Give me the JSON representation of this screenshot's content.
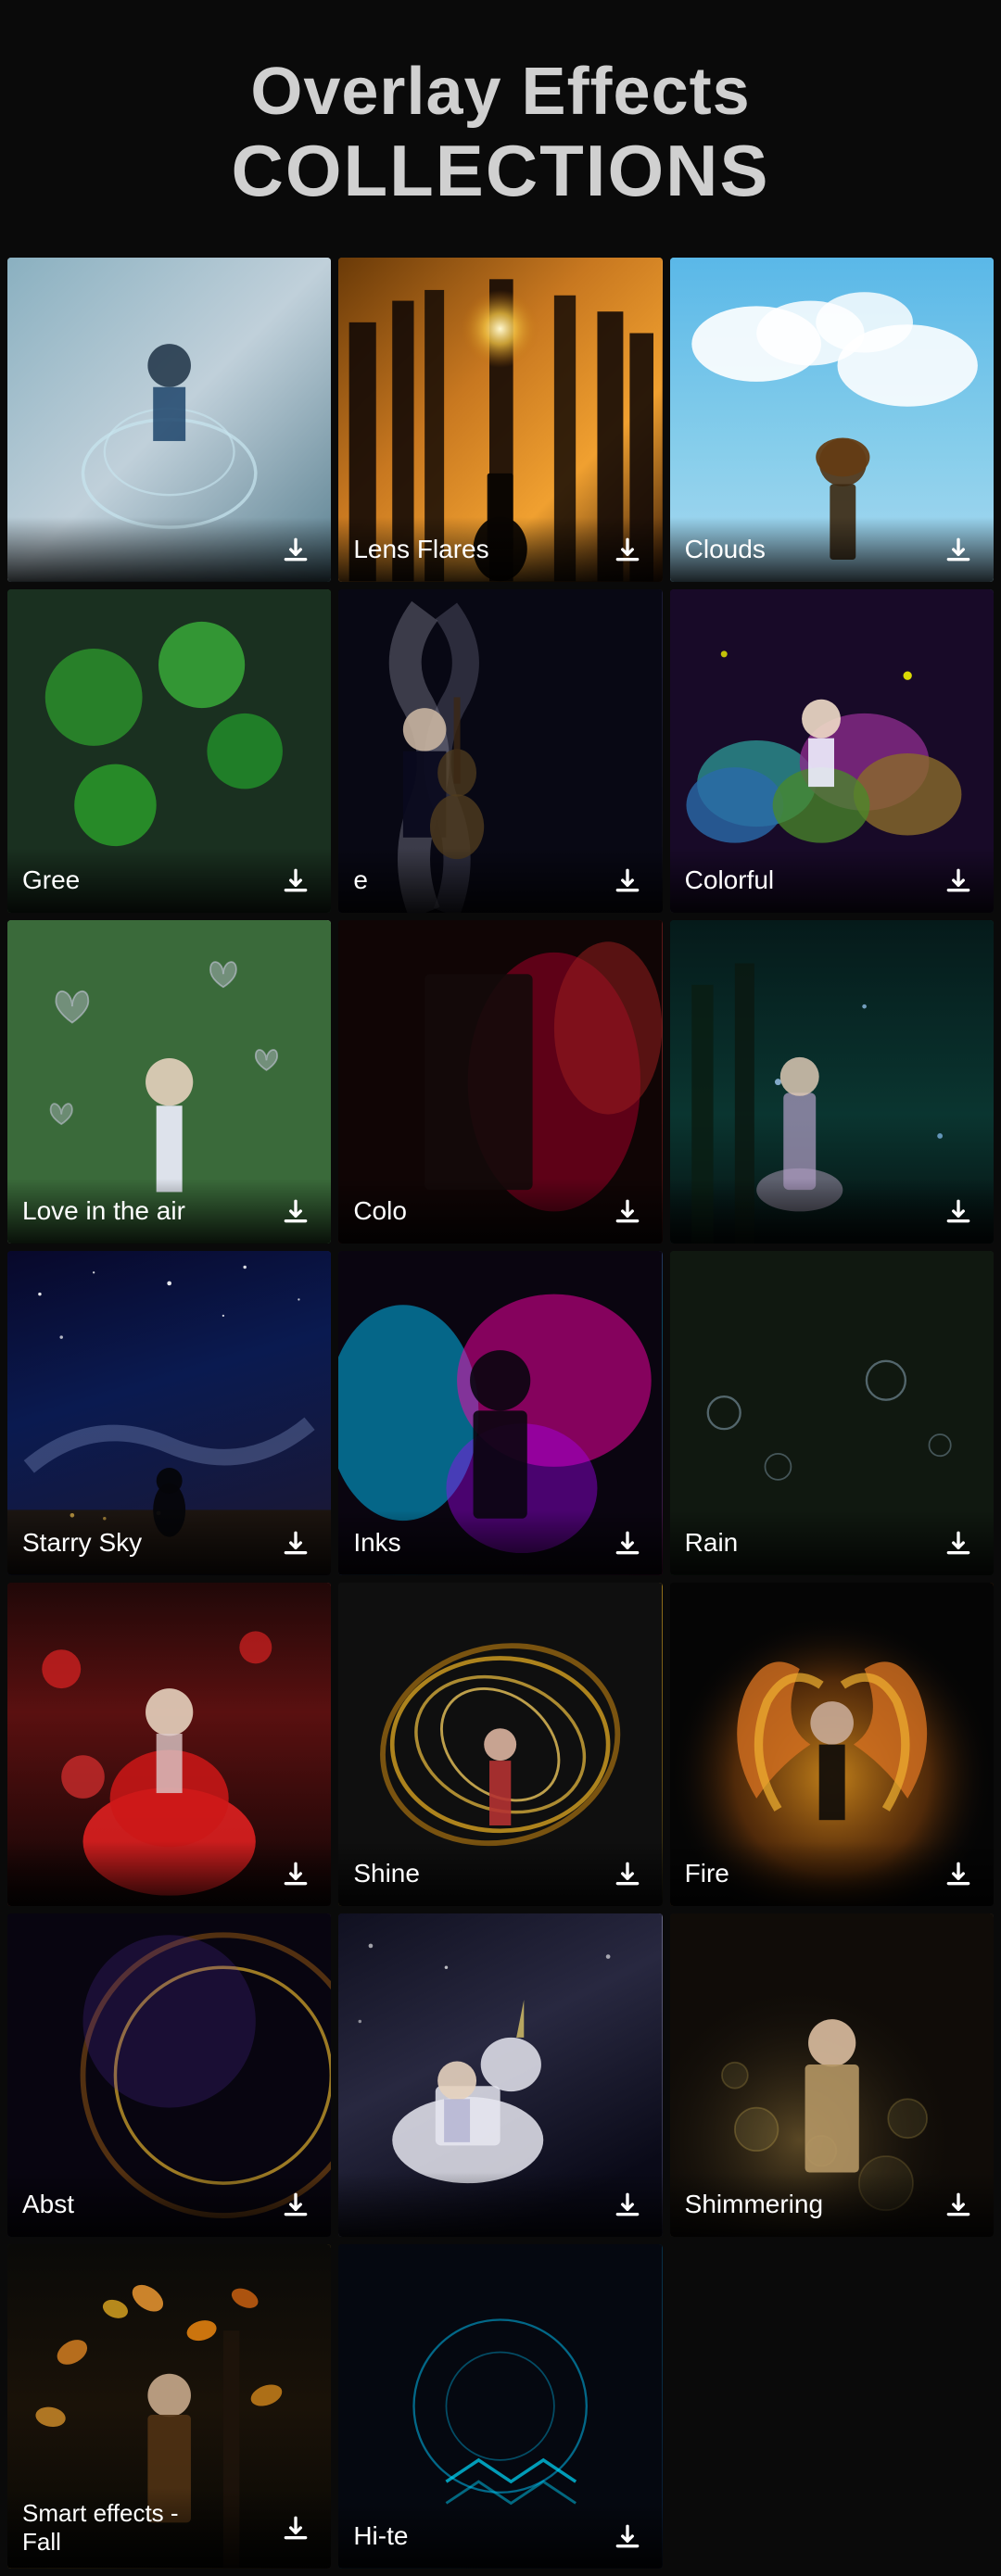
{
  "header": {
    "title": "Overlay Effects",
    "subtitle": "COLLECTIONS"
  },
  "grid": {
    "items": [
      {
        "id": "water-horse",
        "label": "",
        "imgClass": "img-water-horse",
        "hasLabel": false,
        "emoji": "🌊"
      },
      {
        "id": "lens-flares",
        "label": "Lens Flares",
        "imgClass": "img-lens-flare",
        "hasLabel": true,
        "emoji": "✨"
      },
      {
        "id": "clouds",
        "label": "Clouds",
        "imgClass": "img-clouds",
        "hasLabel": true,
        "emoji": "☁️"
      },
      {
        "id": "green-balloons",
        "label": "Gree...",
        "imgClass": "img-green-balloons",
        "hasLabel": true,
        "partial": true,
        "emoji": "🟢"
      },
      {
        "id": "guitar-smoke",
        "label": "e",
        "imgClass": "img-guitar-smoke",
        "hasLabel": true,
        "emoji": "🎸"
      },
      {
        "id": "colorful",
        "label": "Colorful",
        "imgClass": "img-colorful",
        "hasLabel": true,
        "emoji": "🌈"
      },
      {
        "id": "love-in-air",
        "label": "Love in the air",
        "imgClass": "img-love-in-air",
        "hasLabel": true,
        "emoji": "💚"
      },
      {
        "id": "color-smoke",
        "label": "Colo...",
        "imgClass": "img-color-smoke",
        "hasLabel": true,
        "partial": true,
        "emoji": "💨"
      },
      {
        "id": "fairy-forest",
        "label": "",
        "imgClass": "img-fairy-forest",
        "hasLabel": false,
        "emoji": "🧚"
      },
      {
        "id": "starry-sky",
        "label": "Starry Sky",
        "imgClass": "img-starry-sky",
        "hasLabel": true,
        "emoji": "🌌"
      },
      {
        "id": "inks",
        "label": "Inks",
        "imgClass": "img-inks",
        "hasLabel": true,
        "emoji": "💜"
      },
      {
        "id": "rain",
        "label": "Rain",
        "imgClass": "img-rain",
        "hasLabel": true,
        "partial": true,
        "emoji": "🌧️"
      },
      {
        "id": "rose-dress",
        "label": "",
        "imgClass": "img-rose-dress",
        "hasLabel": false,
        "emoji": "🌹"
      },
      {
        "id": "shine",
        "label": "Shine",
        "imgClass": "img-shine",
        "hasLabel": true,
        "emoji": "⭕"
      },
      {
        "id": "fire",
        "label": "Fire",
        "imgClass": "img-fire",
        "hasLabel": true,
        "emoji": "🔥"
      },
      {
        "id": "abstract",
        "label": "Abst...",
        "imgClass": "img-abstract",
        "hasLabel": true,
        "partial": true,
        "emoji": "🌟"
      },
      {
        "id": "unicorn",
        "label": "",
        "imgClass": "img-unicorn",
        "hasLabel": false,
        "emoji": "🦄"
      },
      {
        "id": "shimmering",
        "label": "Shimmering",
        "imgClass": "img-shimmering",
        "hasLabel": true,
        "emoji": "✨"
      },
      {
        "id": "fall",
        "label": "Smart effects - Fall",
        "imgClass": "img-fall",
        "hasLabel": true,
        "emoji": "🍂"
      },
      {
        "id": "hitech",
        "label": "Hi-te...",
        "imgClass": "img-hitech",
        "hasLabel": true,
        "partial": true,
        "emoji": "💠"
      }
    ],
    "downloadLabel": "download"
  },
  "icons": {
    "download": "↓"
  }
}
